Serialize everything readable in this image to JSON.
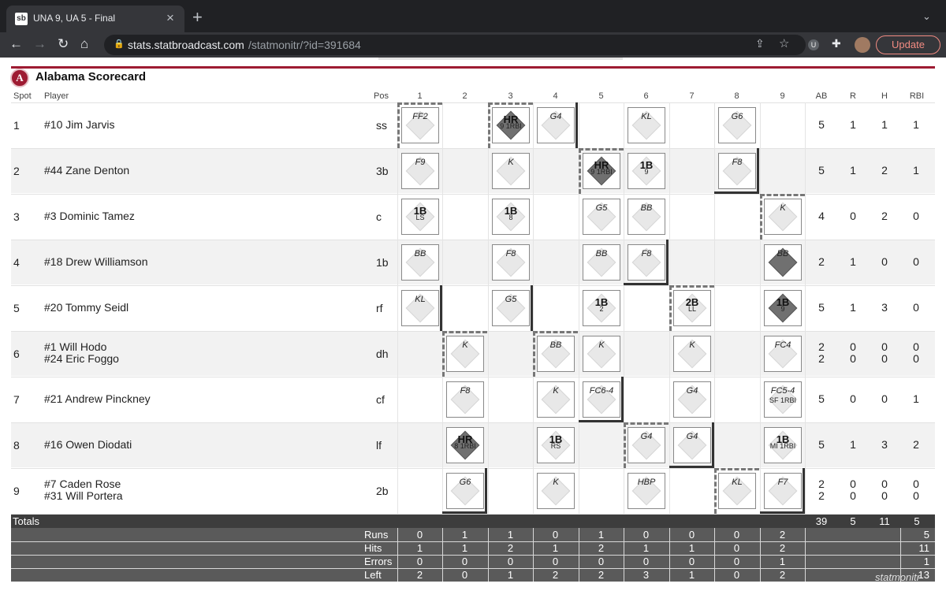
{
  "browser": {
    "tab_title": "UNA 9, UA 5 - Final",
    "tab_icon": "sb",
    "url_host": "stats.statbroadcast.com",
    "url_path": "/statmonitr/?id=391684",
    "update_label": "Update"
  },
  "scorecard": {
    "title": "Alabama Scorecard",
    "logo_letter": "A",
    "headers": {
      "spot": "Spot",
      "player": "Player",
      "pos": "Pos",
      "ab": "AB",
      "r": "R",
      "h": "H",
      "rbi": "RBI"
    },
    "innings": [
      "1",
      "2",
      "3",
      "4",
      "5",
      "6",
      "7",
      "8",
      "9"
    ],
    "rows": [
      {
        "spot": "1",
        "players": [
          "#10 Jim Jarvis"
        ],
        "pos": "ss",
        "ab": [
          "5"
        ],
        "r": [
          "1"
        ],
        "h": [
          "1"
        ],
        "rbi": [
          "1"
        ]
      },
      {
        "spot": "2",
        "players": [
          "#44 Zane Denton"
        ],
        "pos": "3b",
        "ab": [
          "5"
        ],
        "r": [
          "1"
        ],
        "h": [
          "2"
        ],
        "rbi": [
          "1"
        ]
      },
      {
        "spot": "3",
        "players": [
          "#3 Dominic Tamez"
        ],
        "pos": "c",
        "ab": [
          "4"
        ],
        "r": [
          "0"
        ],
        "h": [
          "2"
        ],
        "rbi": [
          "0"
        ]
      },
      {
        "spot": "4",
        "players": [
          "#18 Drew Williamson"
        ],
        "pos": "1b",
        "ab": [
          "2"
        ],
        "r": [
          "1"
        ],
        "h": [
          "0"
        ],
        "rbi": [
          "0"
        ]
      },
      {
        "spot": "5",
        "players": [
          "#20 Tommy Seidl"
        ],
        "pos": "rf",
        "ab": [
          "5"
        ],
        "r": [
          "1"
        ],
        "h": [
          "3"
        ],
        "rbi": [
          "0"
        ]
      },
      {
        "spot": "6",
        "players": [
          "#1 Will Hodo",
          "#24 Eric Foggo"
        ],
        "pos": "dh",
        "ab": [
          "2",
          "2"
        ],
        "r": [
          "0",
          "0"
        ],
        "h": [
          "0",
          "0"
        ],
        "rbi": [
          "0",
          "0"
        ]
      },
      {
        "spot": "7",
        "players": [
          "#21 Andrew Pinckney"
        ],
        "pos": "cf",
        "ab": [
          "5"
        ],
        "r": [
          "0"
        ],
        "h": [
          "0"
        ],
        "rbi": [
          "1"
        ]
      },
      {
        "spot": "8",
        "players": [
          "#16 Owen Diodati"
        ],
        "pos": "lf",
        "ab": [
          "5"
        ],
        "r": [
          "1"
        ],
        "h": [
          "3"
        ],
        "rbi": [
          "2"
        ]
      },
      {
        "spot": "9",
        "players": [
          "#7 Caden Rose",
          "#31 Will Portera"
        ],
        "pos": "2b",
        "ab": [
          "2",
          "2"
        ],
        "r": [
          "0",
          "0"
        ],
        "h": [
          "0",
          "0"
        ],
        "rbi": [
          "0",
          "0"
        ]
      }
    ],
    "plays": [
      {
        "row": 0,
        "inn": 0,
        "res": "FF2"
      },
      {
        "row": 0,
        "inn": 2,
        "res": "HR",
        "sub": "9 1RBI",
        "run": true
      },
      {
        "row": 0,
        "inn": 3,
        "res": "G4"
      },
      {
        "row": 0,
        "inn": 5,
        "res": "KL"
      },
      {
        "row": 0,
        "inn": 7,
        "res": "G6"
      },
      {
        "row": 1,
        "inn": 0,
        "res": "F9"
      },
      {
        "row": 1,
        "inn": 2,
        "res": "K"
      },
      {
        "row": 1,
        "inn": 4,
        "res": "HR",
        "sub": "9 1RBI",
        "run": true
      },
      {
        "row": 1,
        "inn": 5,
        "res": "1B",
        "sub": "9"
      },
      {
        "row": 1,
        "inn": 7,
        "res": "F8"
      },
      {
        "row": 2,
        "inn": 0,
        "res": "1B",
        "sub": "LS"
      },
      {
        "row": 2,
        "inn": 2,
        "res": "1B",
        "sub": "8"
      },
      {
        "row": 2,
        "inn": 4,
        "res": "G5"
      },
      {
        "row": 2,
        "inn": 5,
        "res": "BB"
      },
      {
        "row": 2,
        "inn": 8,
        "res": "K"
      },
      {
        "row": 3,
        "inn": 0,
        "res": "BB"
      },
      {
        "row": 3,
        "inn": 2,
        "res": "F8"
      },
      {
        "row": 3,
        "inn": 4,
        "res": "BB"
      },
      {
        "row": 3,
        "inn": 5,
        "res": "F8"
      },
      {
        "row": 3,
        "inn": 8,
        "res": "BB",
        "run": true
      },
      {
        "row": 4,
        "inn": 0,
        "res": "KL"
      },
      {
        "row": 4,
        "inn": 2,
        "res": "G5"
      },
      {
        "row": 4,
        "inn": 4,
        "res": "1B",
        "sub": "2"
      },
      {
        "row": 4,
        "inn": 6,
        "res": "2B",
        "sub": "LL"
      },
      {
        "row": 4,
        "inn": 8,
        "res": "1B",
        "sub": "9",
        "run": true
      },
      {
        "row": 5,
        "inn": 1,
        "res": "K"
      },
      {
        "row": 5,
        "inn": 3,
        "res": "BB"
      },
      {
        "row": 5,
        "inn": 4,
        "res": "K"
      },
      {
        "row": 5,
        "inn": 6,
        "res": "K"
      },
      {
        "row": 5,
        "inn": 8,
        "res": "FC4"
      },
      {
        "row": 6,
        "inn": 1,
        "res": "F8"
      },
      {
        "row": 6,
        "inn": 3,
        "res": "K"
      },
      {
        "row": 6,
        "inn": 4,
        "res": "FC6-4"
      },
      {
        "row": 6,
        "inn": 6,
        "res": "G4"
      },
      {
        "row": 6,
        "inn": 8,
        "res": "FC5-4",
        "sub": "SF 1RBI"
      },
      {
        "row": 7,
        "inn": 1,
        "res": "HR",
        "sub": "8 1RBI",
        "run": true
      },
      {
        "row": 7,
        "inn": 3,
        "res": "1B",
        "sub": "RS"
      },
      {
        "row": 7,
        "inn": 5,
        "res": "G4"
      },
      {
        "row": 7,
        "inn": 6,
        "res": "G4"
      },
      {
        "row": 7,
        "inn": 8,
        "res": "1B",
        "sub": "MI 1RBI"
      },
      {
        "row": 8,
        "inn": 1,
        "res": "G6"
      },
      {
        "row": 8,
        "inn": 3,
        "res": "K"
      },
      {
        "row": 8,
        "inn": 5,
        "res": "HBP"
      },
      {
        "row": 8,
        "inn": 7,
        "res": "KL"
      },
      {
        "row": 8,
        "inn": 8,
        "res": "F7"
      }
    ],
    "totals": {
      "label": "Totals",
      "ab": "39",
      "r": "5",
      "h": "11",
      "rbi": "5"
    },
    "line_score": [
      {
        "label": "Runs",
        "values": [
          "0",
          "1",
          "1",
          "0",
          "1",
          "0",
          "0",
          "0",
          "2"
        ],
        "total": "5"
      },
      {
        "label": "Hits",
        "values": [
          "1",
          "1",
          "2",
          "1",
          "2",
          "1",
          "1",
          "0",
          "2"
        ],
        "total": "11"
      },
      {
        "label": "Errors",
        "values": [
          "0",
          "0",
          "0",
          "0",
          "0",
          "0",
          "0",
          "0",
          "1"
        ],
        "total": "1"
      },
      {
        "label": "Left",
        "values": [
          "2",
          "0",
          "1",
          "2",
          "2",
          "3",
          "1",
          "0",
          "2"
        ],
        "total": "13"
      }
    ],
    "watermark": "statmonitr"
  }
}
